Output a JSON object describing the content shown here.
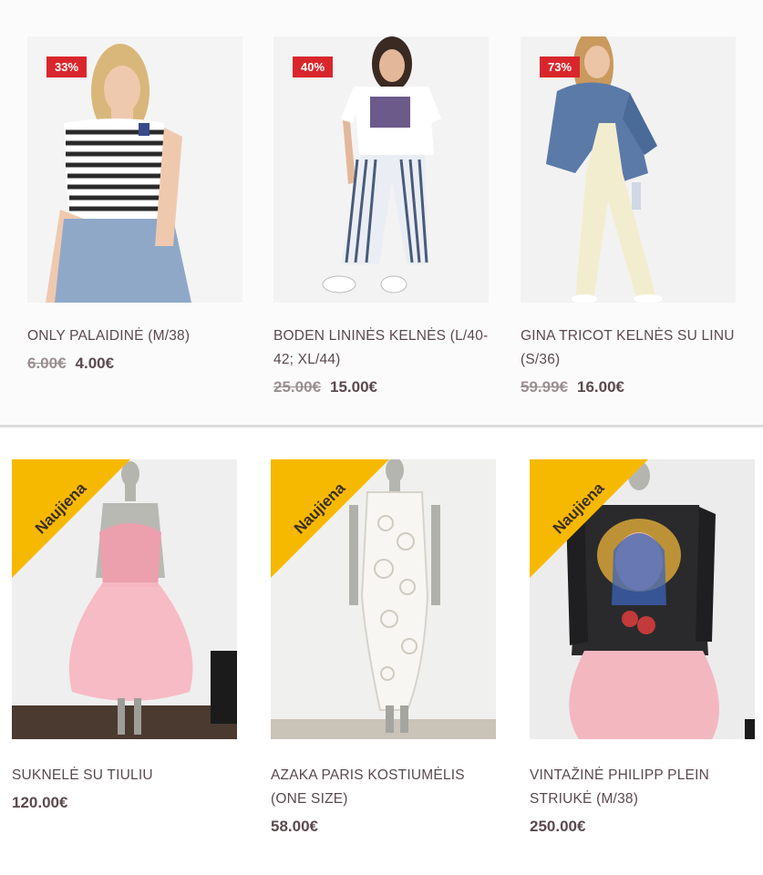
{
  "products_top": [
    {
      "title": "ONLY PALAIDINĖ (M/38)",
      "discount_badge": "33%",
      "old_price": "6.00€",
      "price": "4.00€"
    },
    {
      "title": "BODEN LININĖS KELNĖS (L/40-42; XL/44)",
      "discount_badge": "40%",
      "old_price": "25.00€",
      "price": "15.00€"
    },
    {
      "title": "GINA TRICOT KELNĖS SU LINU (S/36)",
      "discount_badge": "73%",
      "old_price": "59.99€",
      "price": "16.00€"
    }
  ],
  "products_bottom": [
    {
      "title": "SUKNELĖ SU TIULIU",
      "ribbon": "Naujiena",
      "price": "120.00€"
    },
    {
      "title": "AZAKA PARIS KOSTIUMĖLIS (ONE SIZE)",
      "ribbon": "Naujiena",
      "price": "58.00€"
    },
    {
      "title": "VINTAŽINĖ PHILIPP PLEIN STRIUKĖ (M/38)",
      "ribbon": "Naujiena",
      "price": "250.00€"
    }
  ],
  "colors": {
    "sale_badge": "#d9262c",
    "new_ribbon": "#f7b900",
    "text": "#5a4a4e",
    "old_price": "#9a8f91"
  }
}
